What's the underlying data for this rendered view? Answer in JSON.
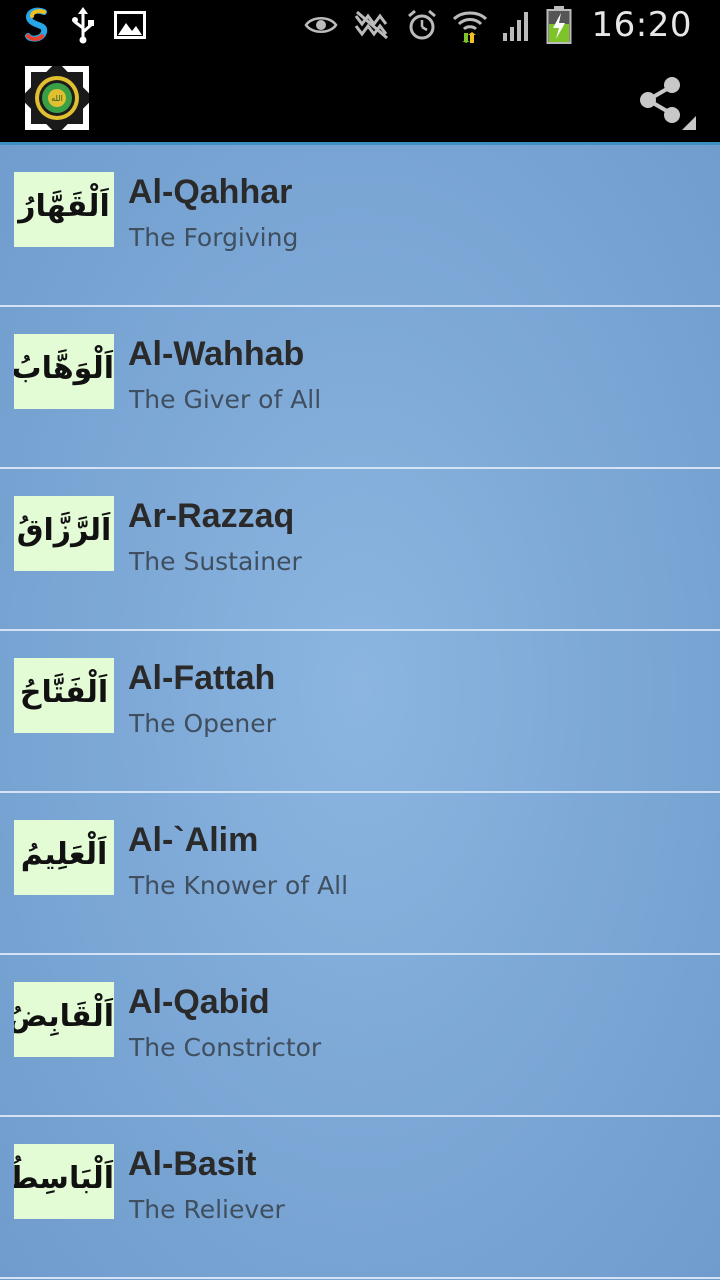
{
  "status_bar": {
    "time": "16:20",
    "icons": [
      "s-app-icon",
      "usb-icon",
      "image-icon",
      "eye-icon",
      "mute-icon",
      "alarm-icon",
      "wifi-icon",
      "signal-icon",
      "battery-charging-icon"
    ]
  },
  "action_bar": {
    "logo_icon": "allah-emblem-icon",
    "share_icon": "share-icon"
  },
  "names": [
    {
      "arabic": "اَلْقَهَّارُ",
      "title": "Al-Qahhar",
      "meaning": "The Forgiving"
    },
    {
      "arabic": "اَلْوَهَّابُ",
      "title": "Al-Wahhab",
      "meaning": "The Giver of All"
    },
    {
      "arabic": "اَلرَّزَّاقُ",
      "title": "Ar-Razzaq",
      "meaning": "The Sustainer"
    },
    {
      "arabic": "اَلْفَتَّاحُ",
      "title": "Al-Fattah",
      "meaning": "The Opener"
    },
    {
      "arabic": "اَلْعَلِيمُ",
      "title": "Al-`Alim",
      "meaning": "The Knower of All"
    },
    {
      "arabic": "اَلْقَابِضُ",
      "title": "Al-Qabid",
      "meaning": "The Constrictor"
    },
    {
      "arabic": "اَلْبَاسِطُ",
      "title": "Al-Basit",
      "meaning": "The Reliever"
    }
  ],
  "colors": {
    "list_background": "#7fa9d7",
    "thumb_background": "#e3fcd6",
    "title_text": "#2a2a2a",
    "subtitle_text": "#3f4f5f",
    "divider": "#d4e3f3",
    "action_bar_accent": "#3d8fc4"
  }
}
